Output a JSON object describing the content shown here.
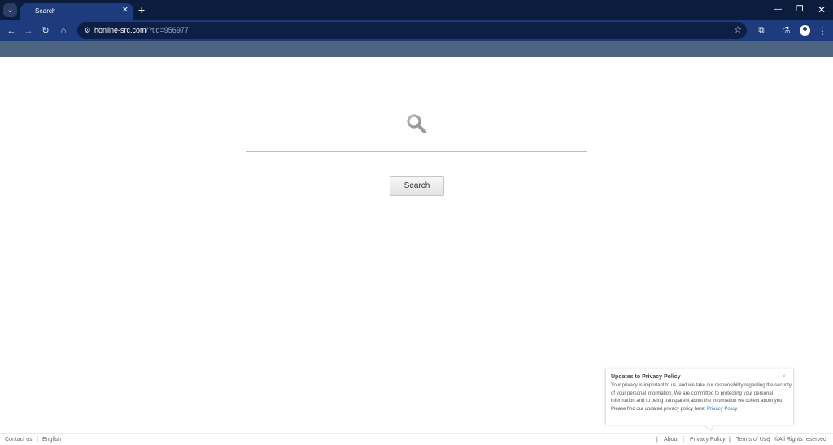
{
  "browser": {
    "tab_title": "Search",
    "url_host": "honline-src.com",
    "url_rest": "/?tid=956977"
  },
  "icons": {
    "tab_menu": "chevron-down-icon",
    "tab_close": "close-icon",
    "new_tab": "plus-icon",
    "minimize": "minimize-icon",
    "restore": "restore-icon",
    "close_window": "close-icon",
    "back": "arrow-left-icon",
    "forward": "arrow-right-icon",
    "reload": "reload-icon",
    "home": "home-icon",
    "site_info": "tune-icon",
    "bookmark": "star-icon",
    "extensions": "puzzle-icon",
    "labs": "flask-icon",
    "profile": "avatar-icon",
    "menu": "kebab-menu-icon",
    "search": "magnifier-icon"
  },
  "search": {
    "input_value": "",
    "button_label": "Search"
  },
  "footer": {
    "contact": "Contact us",
    "separator": "|",
    "language": "English",
    "about": "About",
    "privacy": "Privacy Policy",
    "terms": "Terms of Use",
    "rights": "©All Rights reserved"
  },
  "privacy_popup": {
    "title": "Updates to Privacy Policy",
    "body": "Your privacy is important to us, and we take our responsibility regarding the security of your personal information. We are committed to protecting your personal information and to being transparent about the information we collect about you. Please find our updated privacy policy here:",
    "link": "Privacy Policy",
    "close": "×"
  },
  "colors": {
    "chrome_dark": "#0c1c3c",
    "chrome_toolbar": "#1d3b7d",
    "banner": "#4e6581",
    "input_border": "#9ec3e3",
    "link": "#2a73c8"
  }
}
